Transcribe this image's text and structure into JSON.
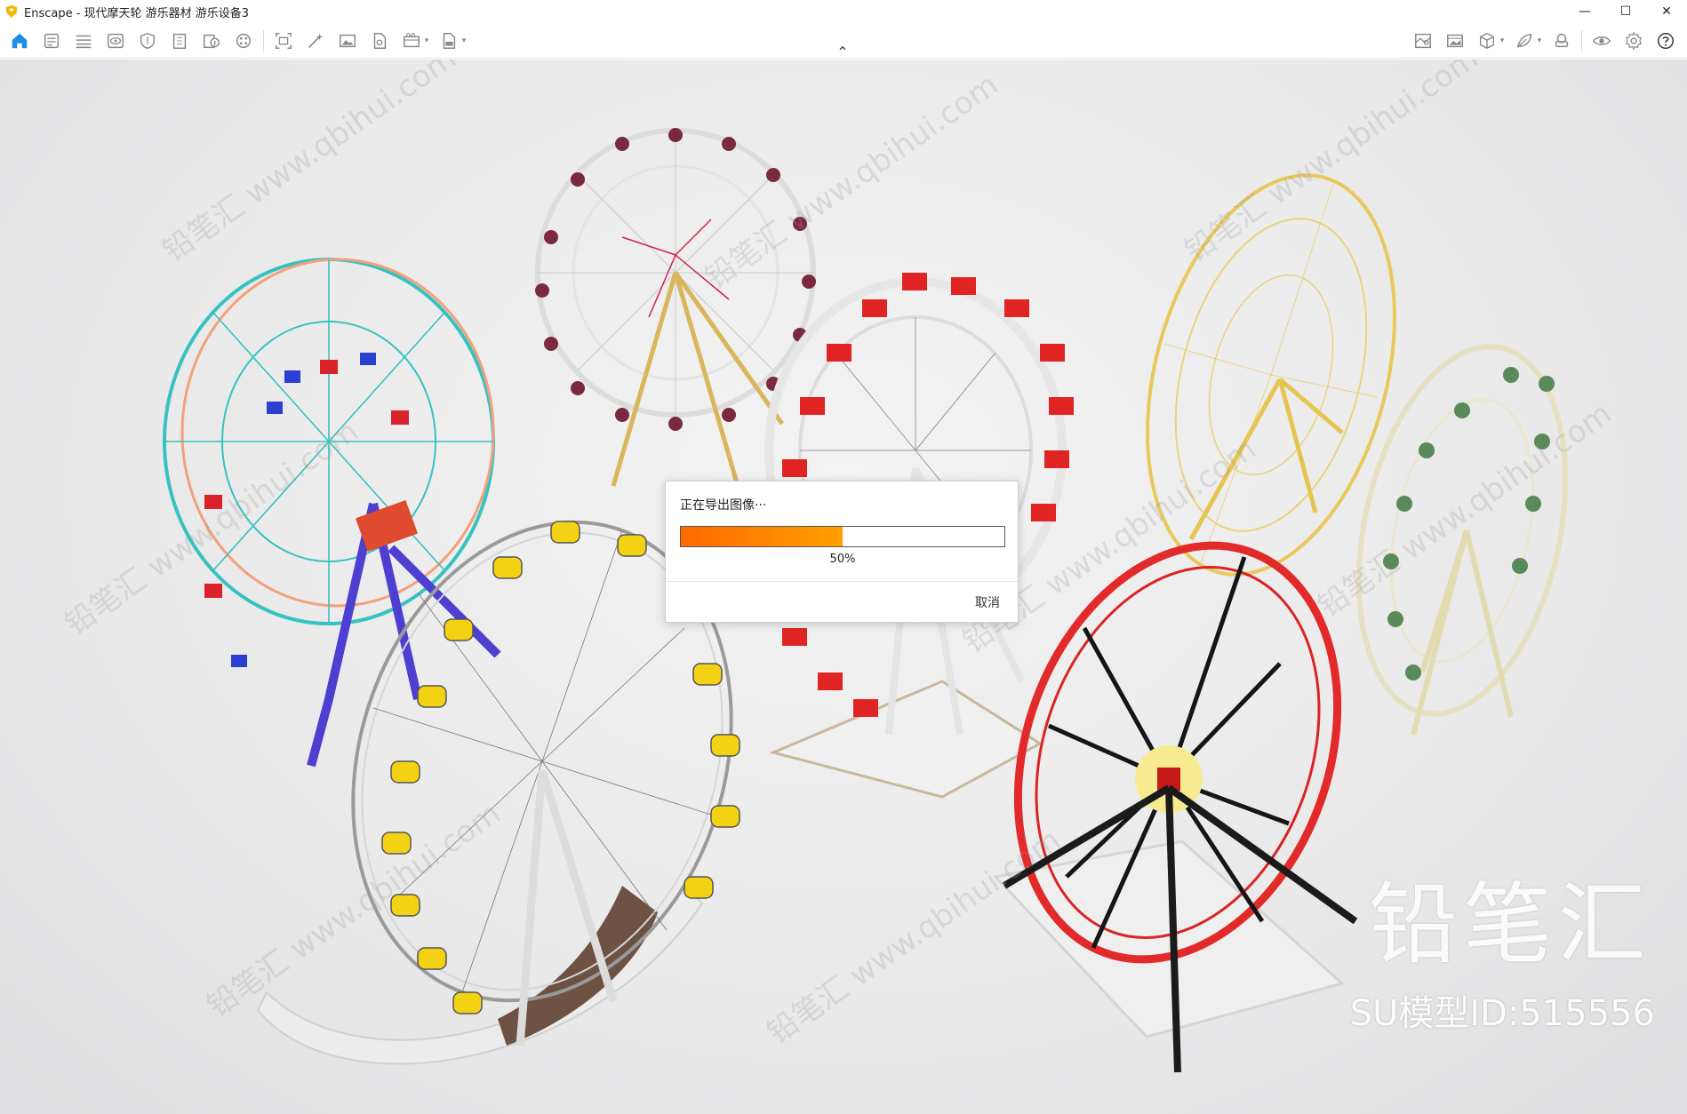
{
  "window": {
    "title": "Enscape - 现代摩天轮 游乐器材 游乐设备3",
    "controls": {
      "minimize": "—",
      "maximize": "☐",
      "close": "✕"
    }
  },
  "toolbar": {
    "left_icons": [
      "home-icon",
      "document-icon",
      "list-icon",
      "eye-panel-icon",
      "shield-icon",
      "building-icon",
      "info-icon",
      "palette-icon",
      "screenshot-icon",
      "magic-wand-icon",
      "image-icon",
      "file-export-icon",
      "video-icon",
      "exe-export-icon"
    ],
    "right_icons": [
      "map-icon",
      "picture-icon",
      "cube-icon",
      "leaf-icon",
      "vr-headset-icon",
      "eye-icon",
      "gear-icon",
      "help-icon"
    ],
    "collapse_glyph": "⌃"
  },
  "dialog": {
    "title": "正在导出图像···",
    "progress": 0.5,
    "progress_label": "50%",
    "cancel_label": "取消"
  },
  "watermark": {
    "brand": "铅笔汇",
    "model_id": "SU模型ID:515556",
    "repeat_text": "铅笔汇 www.qbihui.com"
  },
  "colors": {
    "accent_orange": "#ff7a00",
    "home_blue": "#1a8fe3"
  }
}
